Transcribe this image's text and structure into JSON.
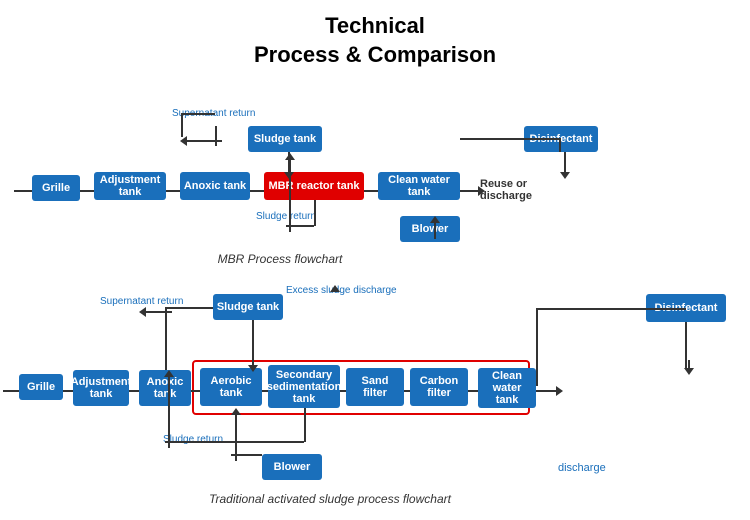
{
  "title": {
    "line1": "Technical",
    "line2": "Process & Comparison"
  },
  "diagram1": {
    "caption": "MBR Process flowchart",
    "boxes": {
      "grille": "Grille",
      "adjustment": "Adjustment tank",
      "anoxic": "Anoxic tank",
      "mbr": "MBR reactor tank",
      "clean_water": "Clean water tank",
      "sludge_tank": "Sludge tank",
      "disinfectant": "Disinfectant",
      "blower": "Blower"
    },
    "labels": {
      "supernatant": "Supernatant return",
      "sludge_return": "Sludge return",
      "reuse": "Reuse or discharge"
    }
  },
  "diagram2": {
    "caption": "Traditional activated sludge process flowchart",
    "boxes": {
      "grille": "Grille",
      "adjustment": "Adjustment tank",
      "anoxic": "Anoxic tank",
      "aerobic": "Aerobic tank",
      "secondary": "Secondary sedimentation tank",
      "sand": "Sand filter",
      "carbon": "Carbon filter",
      "clean_water": "Clean water tank",
      "sludge_tank": "Sludge tank",
      "disinfectant": "Disinfectant",
      "blower": "Blower"
    },
    "labels": {
      "supernatant": "Supernatant return",
      "sludge_return": "Sludge return",
      "excess_sludge": "Excess sludge discharge",
      "discharge": "discharge"
    }
  }
}
